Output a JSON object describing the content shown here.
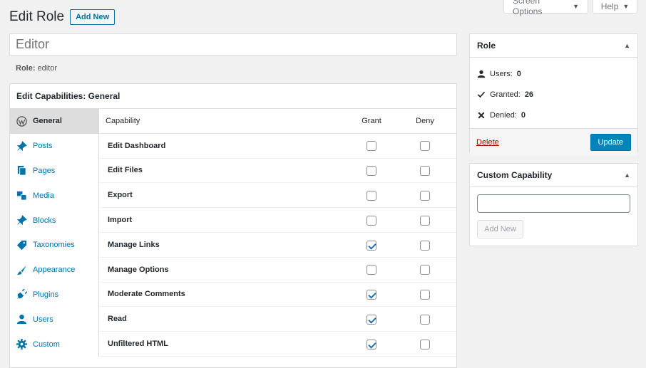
{
  "screen_meta": {
    "screen_options": "Screen Options",
    "help": "Help",
    "caret": "▼"
  },
  "header": {
    "title": "Edit Role",
    "add_new": "Add New"
  },
  "role_name_input": {
    "value": "Editor"
  },
  "role_line": {
    "label": "Role:",
    "value": "editor"
  },
  "capabilities_box": {
    "title": "Edit Capabilities: General",
    "sidebar": [
      {
        "label": "General",
        "icon": "wordpress-icon",
        "active": true
      },
      {
        "label": "Posts",
        "icon": "pin-icon"
      },
      {
        "label": "Pages",
        "icon": "pages-icon"
      },
      {
        "label": "Media",
        "icon": "media-icon"
      },
      {
        "label": "Blocks",
        "icon": "pin-icon"
      },
      {
        "label": "Taxonomies",
        "icon": "tag-icon"
      },
      {
        "label": "Appearance",
        "icon": "brush-icon"
      },
      {
        "label": "Plugins",
        "icon": "plug-icon"
      },
      {
        "label": "Users",
        "icon": "user-icon"
      },
      {
        "label": "Custom",
        "icon": "gear-icon"
      }
    ],
    "columns": {
      "capability": "Capability",
      "grant": "Grant",
      "deny": "Deny"
    },
    "rows": [
      {
        "name": "Edit Dashboard",
        "grant": false,
        "deny": false
      },
      {
        "name": "Edit Files",
        "grant": false,
        "deny": false
      },
      {
        "name": "Export",
        "grant": false,
        "deny": false
      },
      {
        "name": "Import",
        "grant": false,
        "deny": false
      },
      {
        "name": "Manage Links",
        "grant": true,
        "deny": false
      },
      {
        "name": "Manage Options",
        "grant": false,
        "deny": false
      },
      {
        "name": "Moderate Comments",
        "grant": true,
        "deny": false
      },
      {
        "name": "Read",
        "grant": true,
        "deny": false
      },
      {
        "name": "Unfiltered HTML",
        "grant": true,
        "deny": false
      }
    ]
  },
  "role_panel": {
    "title": "Role",
    "users_label": "Users:",
    "users_value": "0",
    "granted_label": "Granted:",
    "granted_value": "26",
    "denied_label": "Denied:",
    "denied_value": "0",
    "delete": "Delete",
    "update": "Update"
  },
  "custom_capability_panel": {
    "title": "Custom Capability",
    "input_value": "",
    "add_new": "Add New"
  },
  "colors": {
    "link": "#0073aa",
    "primary_button": "#0085ba",
    "delete": "#aa0000",
    "checkbox_check": "#2271b1"
  }
}
